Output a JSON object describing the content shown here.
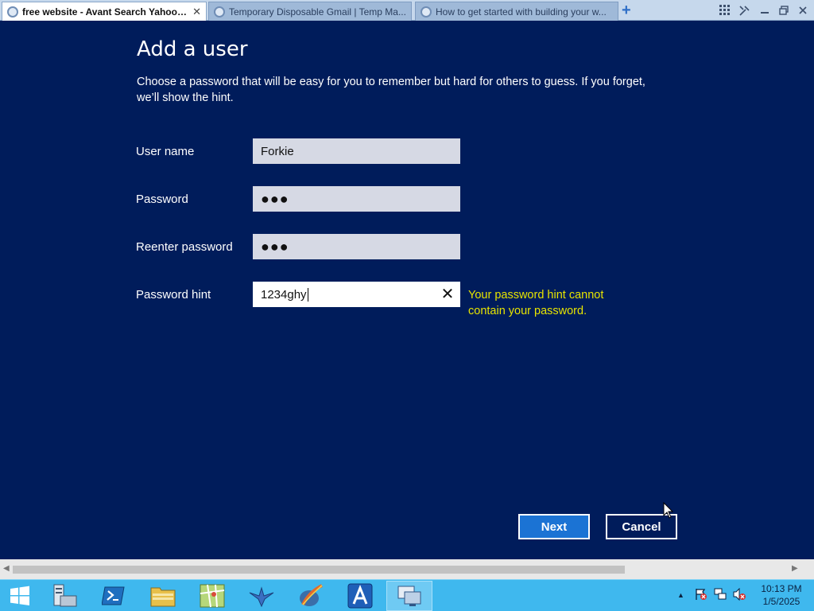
{
  "browser": {
    "tabs": [
      {
        "label": "free website - Avant Search Yahoo Se..."
      },
      {
        "label": "Temporary Disposable Gmail | Temp Ma..."
      },
      {
        "label": "How to get started with building your w..."
      }
    ],
    "close_glyph": "✕",
    "new_tab_glyph": "+"
  },
  "dialog": {
    "title": "Add a user",
    "description": "Choose a password that will be easy for you to remember but hard for others to guess. If you forget, we’ll show the hint.",
    "fields": {
      "username": {
        "label": "User name",
        "value": "Forkie"
      },
      "password": {
        "label": "Password",
        "value": "●●●"
      },
      "reenter": {
        "label": "Reenter password",
        "value": "●●●"
      },
      "hint": {
        "label": "Password hint",
        "value": "1234ghy"
      }
    },
    "clear_glyph": "✕",
    "error": "Your password hint cannot contain your password.",
    "buttons": {
      "next": "Next",
      "cancel": "Cancel"
    }
  },
  "taskbar": {
    "clock_time": "10:13 PM",
    "clock_date": "1/5/2025",
    "tray_up_arrow": "▲",
    "items": [
      "windows-start",
      "server-manager",
      "powershell",
      "file-explorer",
      "maps-app",
      "bird-app",
      "paint-brush-app",
      "avant-browser",
      "remote-desktop"
    ]
  },
  "colors": {
    "background": "#001c5b",
    "error_text": "#e7e400",
    "next_button": "#1b73d4",
    "taskbar": "#3fb8ee"
  }
}
